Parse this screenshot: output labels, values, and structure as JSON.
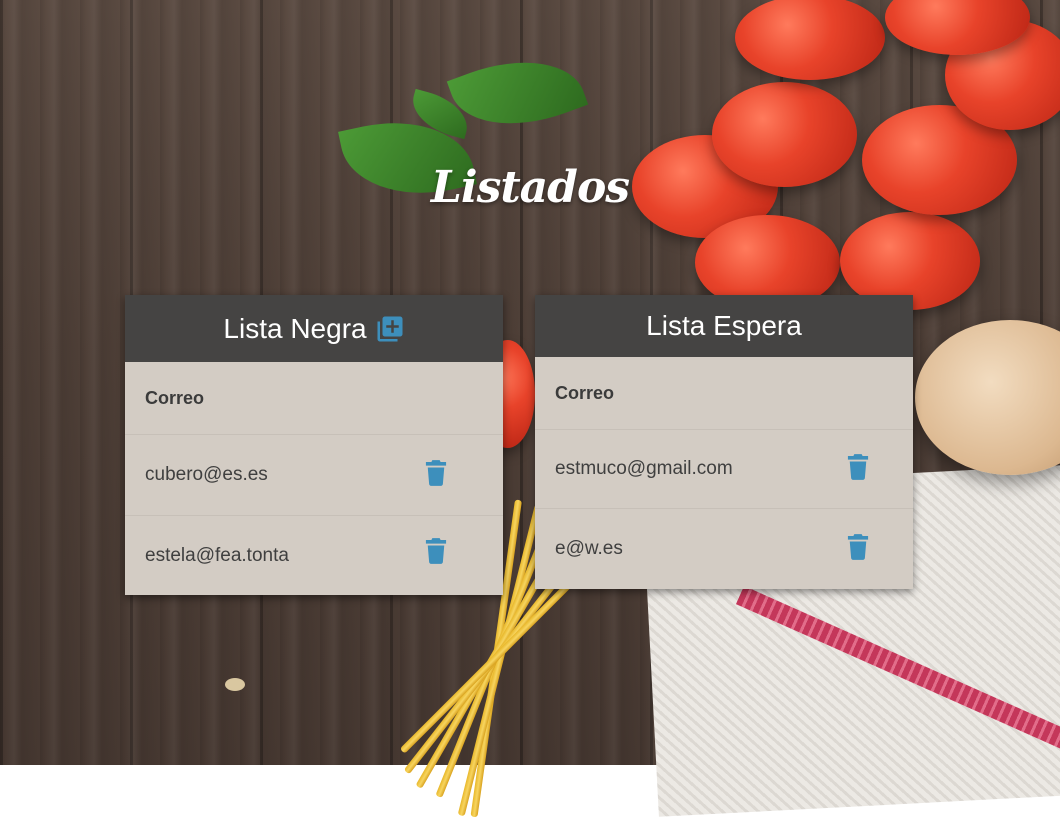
{
  "page": {
    "title": "Listados"
  },
  "lists": [
    {
      "title": "Lista Negra",
      "has_add_button": true,
      "column_header": "Correo",
      "rows": [
        "cubero@es.es",
        "estela@fea.tonta"
      ]
    },
    {
      "title": "Lista Espera",
      "has_add_button": false,
      "column_header": "Correo",
      "rows": [
        "estmuco@gmail.com",
        "e@w.es"
      ]
    }
  ],
  "icons": {
    "add": "library-add-icon",
    "delete": "trash-icon"
  },
  "colors": {
    "accent": "#3d8fbc",
    "header_bg": "#454443",
    "card_bg": "#d3ccc4",
    "text": "#3f3f3f"
  }
}
